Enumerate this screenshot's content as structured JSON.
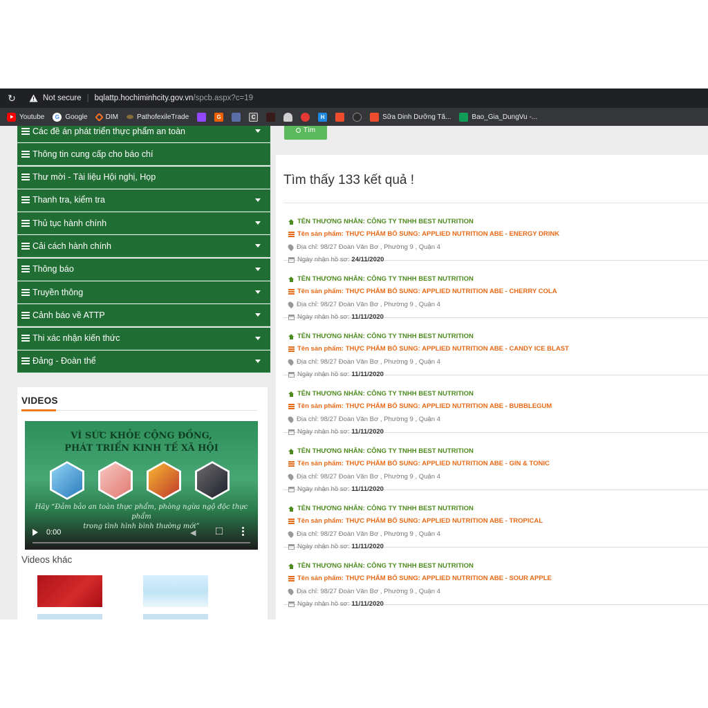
{
  "browser": {
    "not_secure": "Not secure",
    "host": "bqlattp.hochiminhcity.gov.vn",
    "path": "/spcb.aspx?c=19",
    "bookmarks": [
      {
        "label": "Youtube",
        "icon": "youtube-icon",
        "color": "#ff0000"
      },
      {
        "label": "Google",
        "icon": "google-icon",
        "color": "#4285f4"
      },
      {
        "label": "DIM",
        "icon": "dim-icon",
        "color": "#f47321"
      },
      {
        "label": "PathofexileTrade",
        "icon": "poe-icon",
        "color": "#8a6d3b"
      }
    ],
    "bookmarks_tail": [
      {
        "label": "Sữa Dinh Dưỡng Tă...",
        "icon": "shopee-icon",
        "color": "#ee4d2d"
      },
      {
        "label": "Bao_Gia_DungVu -...",
        "icon": "sheets-icon",
        "color": "#0f9d58"
      }
    ]
  },
  "sidebar": {
    "items": [
      {
        "label": "Các đề án phát triển thực phẩm an toàn",
        "has_caret": true
      },
      {
        "label": "Thông tin cung cấp cho báo chí",
        "has_caret": false
      },
      {
        "label": "Thư mời - Tài liệu Hội nghị, Họp",
        "has_caret": false
      },
      {
        "label": "Thanh tra, kiểm tra",
        "has_caret": true
      },
      {
        "label": "Thủ tục hành chính",
        "has_caret": true
      },
      {
        "label": "Cải cách hành chính",
        "has_caret": true
      },
      {
        "label": "Thông báo",
        "has_caret": true
      },
      {
        "label": "Truyền thông",
        "has_caret": true
      },
      {
        "label": "Cảnh báo về ATTP",
        "has_caret": true
      },
      {
        "label": "Thi xác nhận kiến thức",
        "has_caret": true
      },
      {
        "label": "Đảng - Đoàn thể",
        "has_caret": true
      }
    ]
  },
  "videos": {
    "title": "VIDEOS",
    "player": {
      "heading1": "VÌ SỨC KHỎE CỘNG ĐỒNG,",
      "heading2": "PHÁT TRIỂN KINH TẾ XÃ HỘI",
      "quote1": "Hãy “Đảm bảo an toàn thực phẩm, phòng ngừa ngộ độc thực phẩm",
      "quote2": "trong tình hình bình thường mới”",
      "time": "0:00"
    },
    "other_label": "Videos khác"
  },
  "search": {
    "button_label": "Tìm"
  },
  "results": {
    "count_text": "Tìm thấy 133 kết quả !",
    "trader_prefix": "TÊN THƯƠNG NHÂN:",
    "product_prefix": "Tên sản phẩm:",
    "address_prefix": "Địa chỉ:",
    "date_prefix": "Ngày nhận hồ sơ:",
    "items": [
      {
        "trader": "CÔNG TY TNHH BEST NUTRITION",
        "product": "THỰC PHẨM BỔ SUNG: APPLIED NUTRITION ABE - ENERGY DRINK",
        "address": "98/27 Đoàn Văn Bơ , Phường 9 , Quận 4",
        "date": "24/11/2020"
      },
      {
        "trader": "CÔNG TY TNHH BEST NUTRITION",
        "product": "THỰC PHẨM BỔ SUNG: APPLIED NUTRITION ABE - CHERRY COLA",
        "address": "98/27 Đoàn Văn Bơ , Phường 9 , Quận 4",
        "date": "11/11/2020"
      },
      {
        "trader": "CÔNG TY TNHH BEST NUTRITION",
        "product": "THỰC PHẨM BỔ SUNG: APPLIED NUTRITION ABE - CANDY ICE BLAST",
        "address": "98/27 Đoàn Văn Bơ , Phường 9 , Quận 4",
        "date": "11/11/2020"
      },
      {
        "trader": "CÔNG TY TNHH BEST NUTRITION",
        "product": "THỰC PHẨM BỔ SUNG: APPLIED NUTRITION ABE - BUBBLEGUM",
        "address": "98/27 Đoàn Văn Bơ , Phường 9 , Quận 4",
        "date": "11/11/2020"
      },
      {
        "trader": "CÔNG TY TNHH BEST NUTRITION",
        "product": "THỰC PHẨM BỔ SUNG: APPLIED NUTRITION ABE - GIN & TONIC",
        "address": "98/27 Đoàn Văn Bơ , Phường 9 , Quận 4",
        "date": "11/11/2020"
      },
      {
        "trader": "CÔNG TY TNHH BEST NUTRITION",
        "product": "THỰC PHẨM BỔ SUNG: APPLIED NUTRITION ABE - TROPICAL",
        "address": "98/27 Đoàn Văn Bơ , Phường 9 , Quận 4",
        "date": "11/11/2020"
      },
      {
        "trader": "CÔNG TY TNHH BEST NUTRITION",
        "product": "THỰC PHẨM BỔ SUNG: APPLIED NUTRITION ABE - SOUR APPLE",
        "address": "98/27 Đoàn Văn Bơ , Phường 9 , Quận 4",
        "date": "11/11/2020"
      }
    ]
  },
  "colors": {
    "menu_green": "#216e34",
    "trader_green": "#4d8b1f",
    "product_orange": "#e86a17",
    "accent_orange": "#f07a1e",
    "button_green": "#5cb85c"
  }
}
